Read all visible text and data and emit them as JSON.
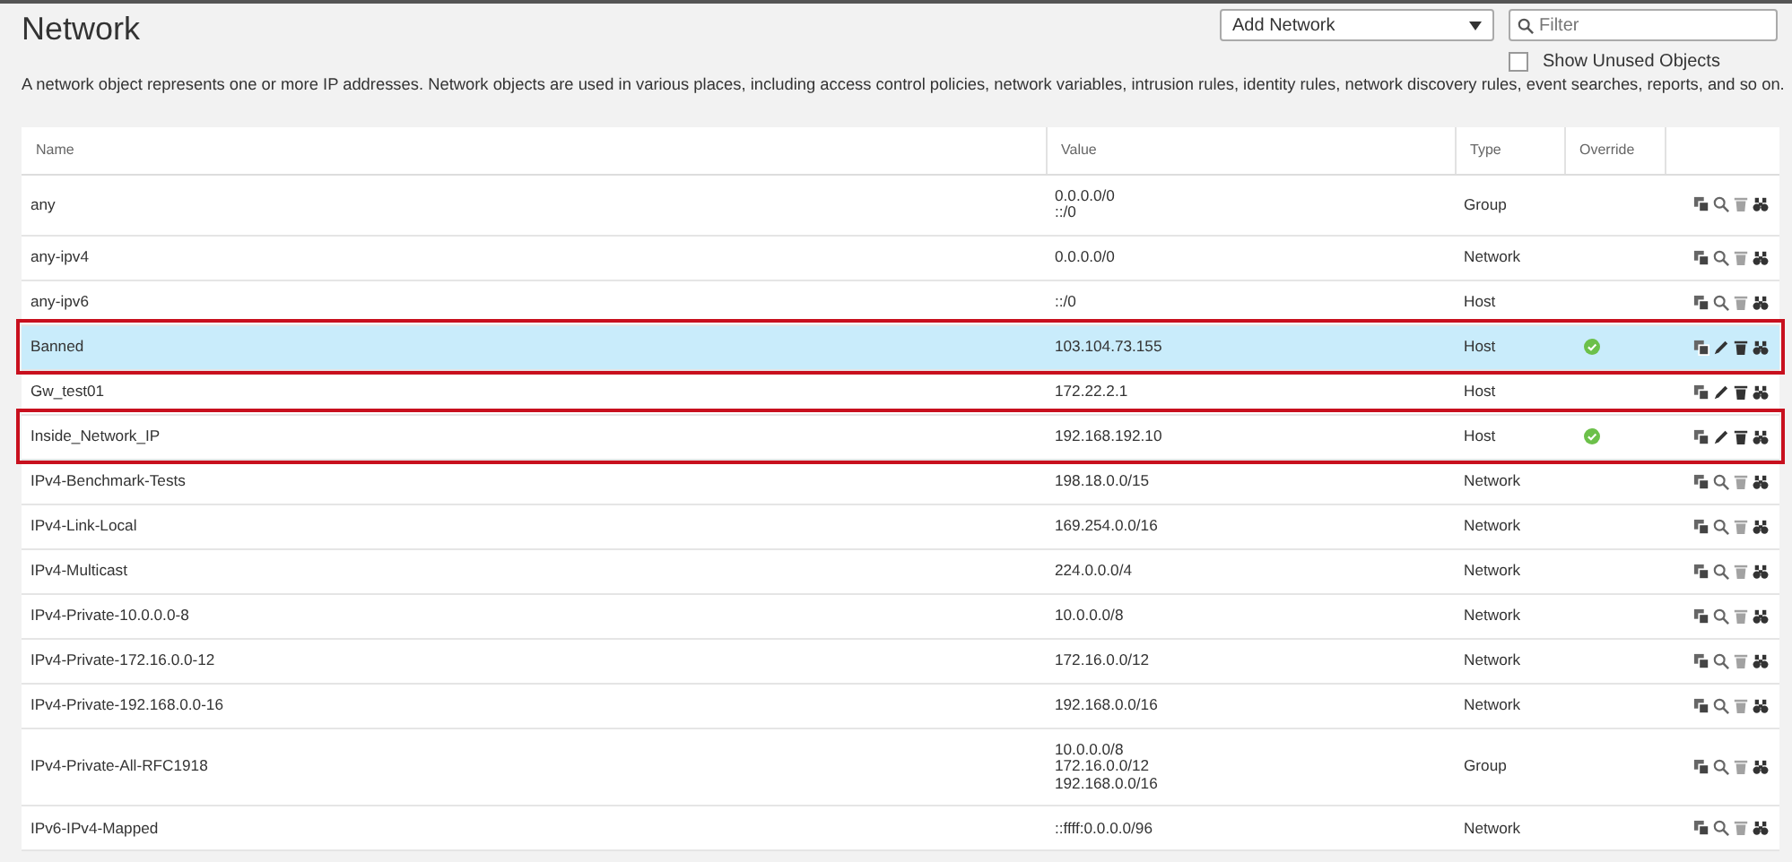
{
  "page": {
    "title": "Network",
    "description": "A network object represents one or more IP addresses. Network objects are used in various places, including access control policies, network variables, intrusion rules, identity rules, network discovery rules, event searches, reports, and so on."
  },
  "add_menu": {
    "label": "Add Network"
  },
  "filter": {
    "placeholder": "Filter"
  },
  "show_unused": {
    "label": "Show Unused Objects",
    "checked": false
  },
  "table": {
    "columns": [
      "Name",
      "Value",
      "Type",
      "Override"
    ],
    "rows": [
      {
        "name": "any",
        "value": [
          "0.0.0.0/0",
          "::/0"
        ],
        "type": "Group",
        "override": false,
        "editable": false,
        "selected": false,
        "highlighted": false
      },
      {
        "name": "any-ipv4",
        "value": [
          "0.0.0.0/0"
        ],
        "type": "Network",
        "override": false,
        "editable": false,
        "selected": false,
        "highlighted": false
      },
      {
        "name": "any-ipv6",
        "value": [
          "::/0"
        ],
        "type": "Host",
        "override": false,
        "editable": false,
        "selected": false,
        "highlighted": false
      },
      {
        "name": "Banned",
        "value": [
          "103.104.73.155"
        ],
        "type": "Host",
        "override": true,
        "editable": true,
        "selected": true,
        "highlighted": true
      },
      {
        "name": "Gw_test01",
        "value": [
          "172.22.2.1"
        ],
        "type": "Host",
        "override": false,
        "editable": true,
        "selected": false,
        "highlighted": false
      },
      {
        "name": "Inside_Network_IP",
        "value": [
          "192.168.192.10"
        ],
        "type": "Host",
        "override": true,
        "editable": true,
        "selected": false,
        "highlighted": true
      },
      {
        "name": "IPv4-Benchmark-Tests",
        "value": [
          "198.18.0.0/15"
        ],
        "type": "Network",
        "override": false,
        "editable": false,
        "selected": false,
        "highlighted": false
      },
      {
        "name": "IPv4-Link-Local",
        "value": [
          "169.254.0.0/16"
        ],
        "type": "Network",
        "override": false,
        "editable": false,
        "selected": false,
        "highlighted": false
      },
      {
        "name": "IPv4-Multicast",
        "value": [
          "224.0.0.0/4"
        ],
        "type": "Network",
        "override": false,
        "editable": false,
        "selected": false,
        "highlighted": false
      },
      {
        "name": "IPv4-Private-10.0.0.0-8",
        "value": [
          "10.0.0.0/8"
        ],
        "type": "Network",
        "override": false,
        "editable": false,
        "selected": false,
        "highlighted": false
      },
      {
        "name": "IPv4-Private-172.16.0.0-12",
        "value": [
          "172.16.0.0/12"
        ],
        "type": "Network",
        "override": false,
        "editable": false,
        "selected": false,
        "highlighted": false
      },
      {
        "name": "IPv4-Private-192.168.0.0-16",
        "value": [
          "192.168.0.0/16"
        ],
        "type": "Network",
        "override": false,
        "editable": false,
        "selected": false,
        "highlighted": false
      },
      {
        "name": "IPv4-Private-All-RFC1918",
        "value": [
          "10.0.0.0/8",
          "172.16.0.0/12",
          "192.168.0.0/16"
        ],
        "type": "Group",
        "override": false,
        "editable": false,
        "selected": false,
        "highlighted": false
      },
      {
        "name": "IPv6-IPv4-Mapped",
        "value": [
          "::ffff:0.0.0.0/96"
        ],
        "type": "Network",
        "override": false,
        "editable": false,
        "selected": false,
        "highlighted": false
      }
    ]
  }
}
